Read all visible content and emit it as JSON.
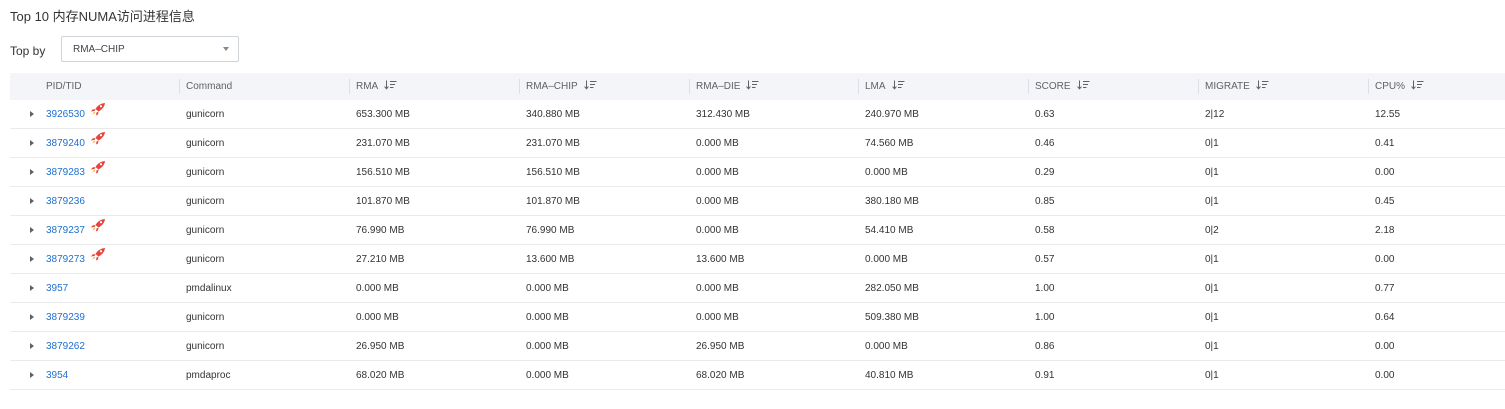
{
  "title": "Top 10 内存NUMA访问进程信息",
  "top_by": {
    "label": "Top by",
    "selected": "RMA–CHIP"
  },
  "columns": [
    {
      "label": "PID/TID",
      "sortable": false
    },
    {
      "label": "Command",
      "sortable": false
    },
    {
      "label": "RMA",
      "sortable": true
    },
    {
      "label": "RMA–CHIP",
      "sortable": true
    },
    {
      "label": "RMA–DIE",
      "sortable": true
    },
    {
      "label": "LMA",
      "sortable": true
    },
    {
      "label": "SCORE",
      "sortable": true
    },
    {
      "label": "MIGRATE",
      "sortable": true
    },
    {
      "label": "CPU%",
      "sortable": true
    }
  ],
  "rows": [
    {
      "pid": "3926530",
      "rocket": true,
      "command": "gunicorn",
      "rma": "653.300 MB",
      "rma_chip": "340.880 MB",
      "rma_die": "312.430 MB",
      "lma": "240.970 MB",
      "score": "0.63",
      "migrate": "2|12",
      "cpu": "12.55"
    },
    {
      "pid": "3879240",
      "rocket": true,
      "command": "gunicorn",
      "rma": "231.070 MB",
      "rma_chip": "231.070 MB",
      "rma_die": "0.000 MB",
      "lma": "74.560 MB",
      "score": "0.46",
      "migrate": "0|1",
      "cpu": "0.41"
    },
    {
      "pid": "3879283",
      "rocket": true,
      "command": "gunicorn",
      "rma": "156.510 MB",
      "rma_chip": "156.510 MB",
      "rma_die": "0.000 MB",
      "lma": "0.000 MB",
      "score": "0.29",
      "migrate": "0|1",
      "cpu": "0.00"
    },
    {
      "pid": "3879236",
      "rocket": false,
      "command": "gunicorn",
      "rma": "101.870 MB",
      "rma_chip": "101.870 MB",
      "rma_die": "0.000 MB",
      "lma": "380.180 MB",
      "score": "0.85",
      "migrate": "0|1",
      "cpu": "0.45"
    },
    {
      "pid": "3879237",
      "rocket": true,
      "command": "gunicorn",
      "rma": "76.990 MB",
      "rma_chip": "76.990 MB",
      "rma_die": "0.000 MB",
      "lma": "54.410 MB",
      "score": "0.58",
      "migrate": "0|2",
      "cpu": "2.18"
    },
    {
      "pid": "3879273",
      "rocket": true,
      "command": "gunicorn",
      "rma": "27.210 MB",
      "rma_chip": "13.600 MB",
      "rma_die": "13.600 MB",
      "lma": "0.000 MB",
      "score": "0.57",
      "migrate": "0|1",
      "cpu": "0.00"
    },
    {
      "pid": "3957",
      "rocket": false,
      "command": "pmdalinux",
      "rma": "0.000 MB",
      "rma_chip": "0.000 MB",
      "rma_die": "0.000 MB",
      "lma": "282.050 MB",
      "score": "1.00",
      "migrate": "0|1",
      "cpu": "0.77"
    },
    {
      "pid": "3879239",
      "rocket": false,
      "command": "gunicorn",
      "rma": "0.000 MB",
      "rma_chip": "0.000 MB",
      "rma_die": "0.000 MB",
      "lma": "509.380 MB",
      "score": "1.00",
      "migrate": "0|1",
      "cpu": "0.64"
    },
    {
      "pid": "3879262",
      "rocket": false,
      "command": "gunicorn",
      "rma": "26.950 MB",
      "rma_chip": "0.000 MB",
      "rma_die": "26.950 MB",
      "lma": "0.000 MB",
      "score": "0.86",
      "migrate": "0|1",
      "cpu": "0.00"
    },
    {
      "pid": "3954",
      "rocket": false,
      "command": "pmdaproc",
      "rma": "68.020 MB",
      "rma_chip": "0.000 MB",
      "rma_die": "68.020 MB",
      "lma": "40.810 MB",
      "score": "0.91",
      "migrate": "0|1",
      "cpu": "0.00"
    }
  ],
  "icons": {
    "sort": "sort-descending-icon",
    "rocket": "rocket-icon",
    "expand": "caret-right-icon",
    "dropdown": "caret-down-icon"
  },
  "colors": {
    "link": "#1f6fd1",
    "rocket": "#e8443a",
    "header_bg": "#f3f5f8"
  }
}
